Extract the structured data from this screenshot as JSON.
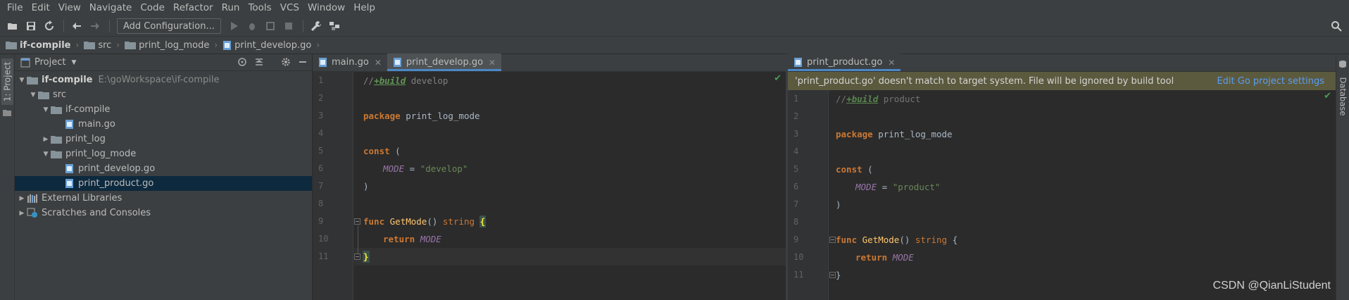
{
  "menu": [
    "File",
    "Edit",
    "View",
    "Navigate",
    "Code",
    "Refactor",
    "Run",
    "Tools",
    "VCS",
    "Window",
    "Help"
  ],
  "toolbar": {
    "add_config_label": "Add Configuration..."
  },
  "breadcrumb": {
    "project": "if-compile",
    "items": [
      "src",
      "print_log_mode",
      "print_develop.go"
    ]
  },
  "left_strip": {
    "project_tab": "1: Project"
  },
  "right_strip": {
    "database_tab": "Database"
  },
  "project_panel": {
    "title": "Project",
    "root": {
      "name": "if-compile",
      "path": "E:\\goWorkspace\\if-compile"
    },
    "nodes": [
      "src",
      "if-compile",
      "main.go",
      "print_log",
      "print_log_mode",
      "print_develop.go",
      "print_product.go",
      "External Libraries",
      "Scratches and Consoles"
    ]
  },
  "left_editor": {
    "tabs": [
      "main.go",
      "print_develop.go"
    ],
    "lines": {
      "l1a": "//",
      "l1b": "+build",
      "l1c": " develop",
      "l3a": "package",
      "l3b": " print_log_mode",
      "l5a": "const",
      "l5b": " (",
      "l6a": "MODE",
      "l6b": " = ",
      "l6c": "\"develop\"",
      "l7": ")",
      "l9a": "func",
      "l9b": "GetMode",
      "l9c": "() ",
      "l9d": "string",
      "l9e": "{",
      "l10a": "return",
      "l10b": "MODE",
      "l11": "}"
    }
  },
  "right_editor": {
    "tabs": [
      "print_product.go"
    ],
    "warning": "'print_product.go' doesn't match to target system. File will be ignored by build tool",
    "warning_link": "Edit Go project settings",
    "lines": {
      "l1a": "//",
      "l1b": "+build",
      "l1c": " product",
      "l3a": "package",
      "l3b": " print_log_mode",
      "l5a": "const",
      "l5b": " (",
      "l6a": "MODE",
      "l6b": " = ",
      "l6c": "\"product\"",
      "l7": ")",
      "l9a": "func",
      "l9b": "GetMode",
      "l9c": "() ",
      "l9d": "string",
      "l9e": " {",
      "l10a": "return",
      "l10b": "MODE",
      "l11": "}"
    }
  },
  "line_numbers": [
    "1",
    "2",
    "3",
    "4",
    "5",
    "6",
    "7",
    "8",
    "9",
    "10",
    "11"
  ],
  "watermark": "CSDN @QianLiStudent"
}
